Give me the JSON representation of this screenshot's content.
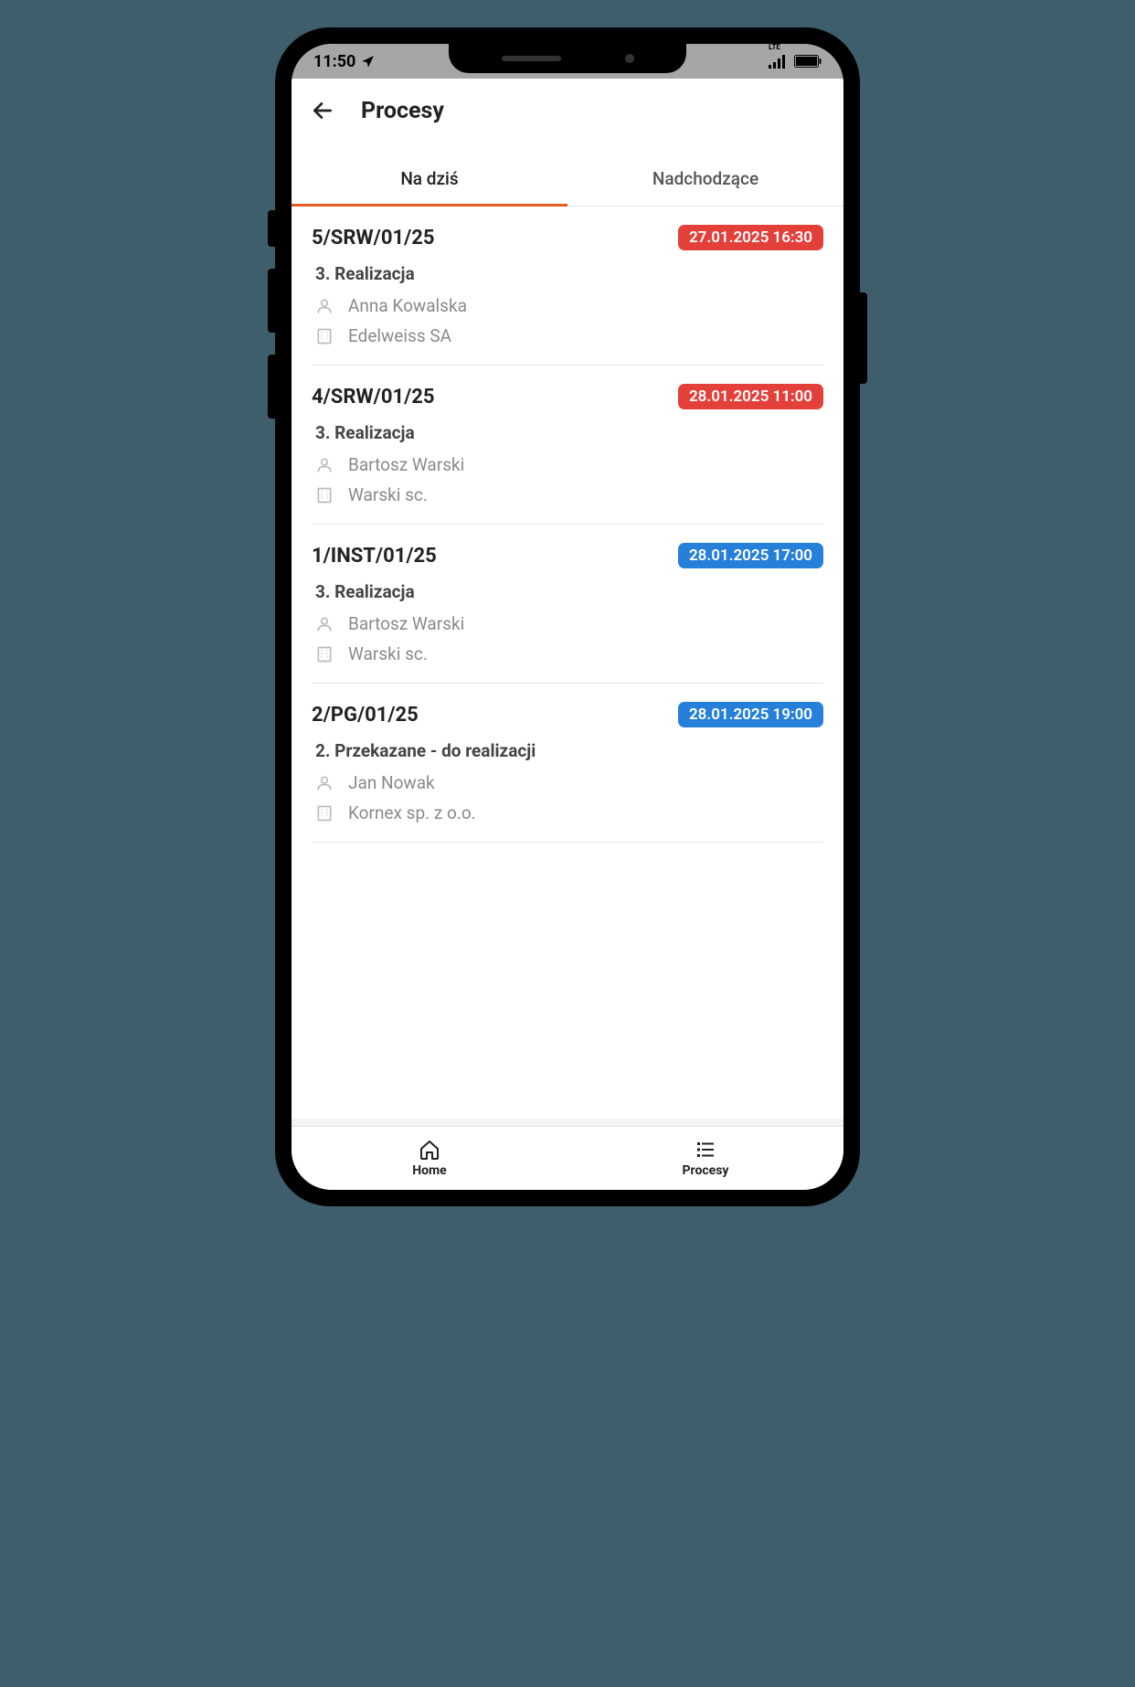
{
  "status_bar": {
    "time": "11:50",
    "network_type": "LTE"
  },
  "header": {
    "title": "Procesy"
  },
  "tabs": [
    {
      "label": "Na dziś",
      "active": true
    },
    {
      "label": "Nadchodzące",
      "active": false
    }
  ],
  "processes": [
    {
      "id": "5/SRW/01/25",
      "datetime": "27.01.2025 16:30",
      "badge_color": "red",
      "status": "3. Realizacja",
      "person": "Anna Kowalska",
      "company": "Edelweiss SA"
    },
    {
      "id": "4/SRW/01/25",
      "datetime": "28.01.2025 11:00",
      "badge_color": "red",
      "status": "3. Realizacja",
      "person": "Bartosz Warski",
      "company": "Warski sc."
    },
    {
      "id": "1/INST/01/25",
      "datetime": "28.01.2025 17:00",
      "badge_color": "blue",
      "status": "3. Realizacja",
      "person": "Bartosz Warski",
      "company": "Warski sc."
    },
    {
      "id": "2/PG/01/25",
      "datetime": "28.01.2025 19:00",
      "badge_color": "blue",
      "status": "2. Przekazane - do realizacji",
      "person": "Jan Nowak",
      "company": "Kornex sp. z o.o."
    }
  ],
  "bottom_nav": [
    {
      "label": "Home",
      "icon": "home"
    },
    {
      "label": "Procesy",
      "icon": "list"
    }
  ]
}
